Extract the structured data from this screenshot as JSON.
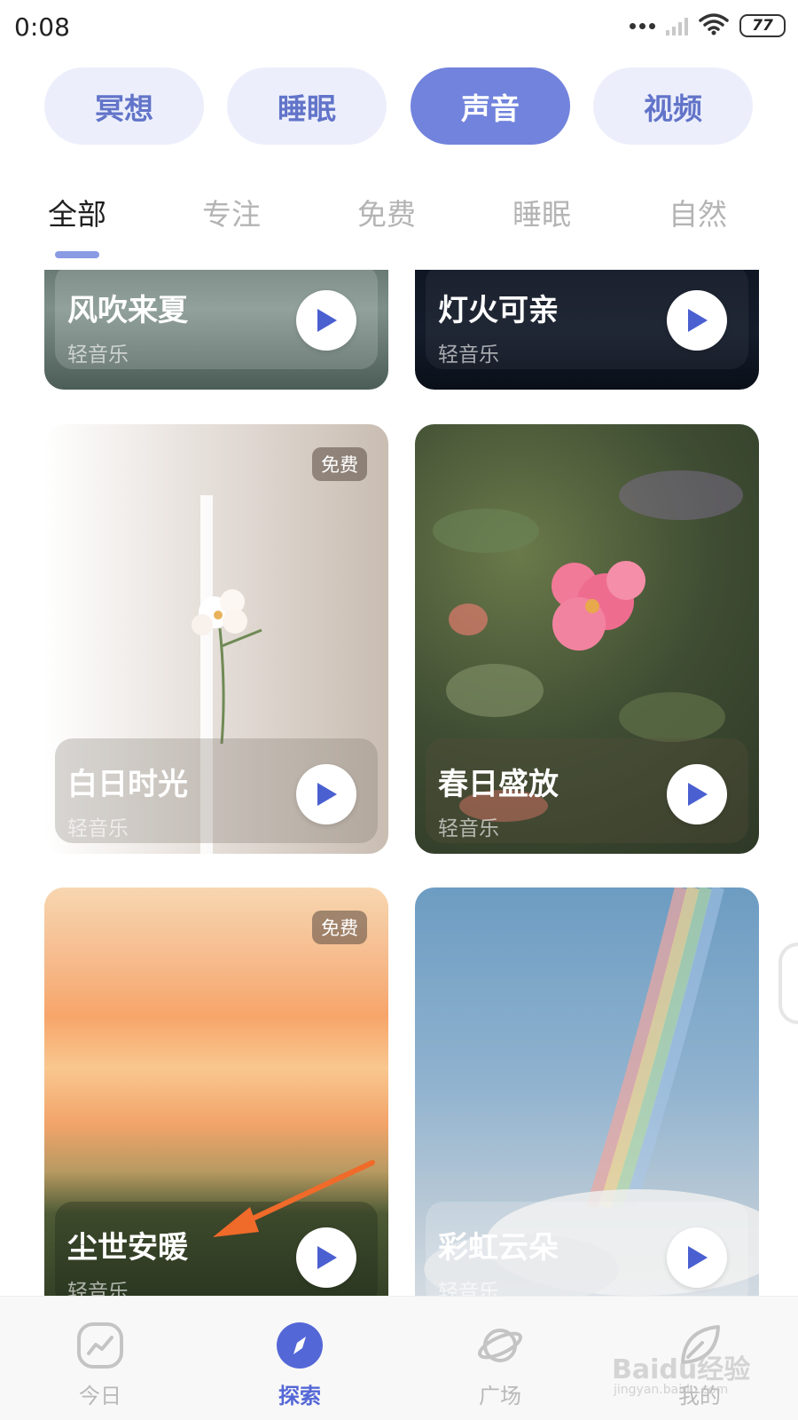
{
  "status_bar": {
    "time": "0:08",
    "battery": "77"
  },
  "categories": [
    {
      "label": "冥想",
      "active": false
    },
    {
      "label": "睡眠",
      "active": false
    },
    {
      "label": "声音",
      "active": true
    },
    {
      "label": "视频",
      "active": false
    }
  ],
  "subtabs": [
    {
      "label": "全部",
      "active": true
    },
    {
      "label": "专注",
      "active": false
    },
    {
      "label": "免费",
      "active": false
    },
    {
      "label": "睡眠",
      "active": false
    },
    {
      "label": "自然",
      "active": false
    }
  ],
  "cards": [
    {
      "title": "风吹来夏",
      "subtitle": "轻音乐"
    },
    {
      "title": "灯火可亲",
      "subtitle": "轻音乐"
    },
    {
      "title": "白日时光",
      "subtitle": "轻音乐",
      "badge": "免费"
    },
    {
      "title": "春日盛放",
      "subtitle": "轻音乐"
    },
    {
      "title": "尘世安暖",
      "subtitle": "轻音乐",
      "badge": "免费"
    },
    {
      "title": "彩虹云朵",
      "subtitle": "轻音乐"
    }
  ],
  "bottom_nav": [
    {
      "label": "今日",
      "icon": "trend-icon",
      "active": false
    },
    {
      "label": "探索",
      "icon": "compass-icon",
      "active": true
    },
    {
      "label": "广场",
      "icon": "planet-icon",
      "active": false
    },
    {
      "label": "我的",
      "icon": "leaf-icon",
      "active": false
    }
  ],
  "watermark": {
    "text": "Baidu经验",
    "sub": "jingyan.baidu.com"
  },
  "colors": {
    "accent": "#7183dc",
    "pill_bg": "#eceffb",
    "play_icon": "#4a5fd0",
    "annotation_arrow": "#f06a2a"
  }
}
